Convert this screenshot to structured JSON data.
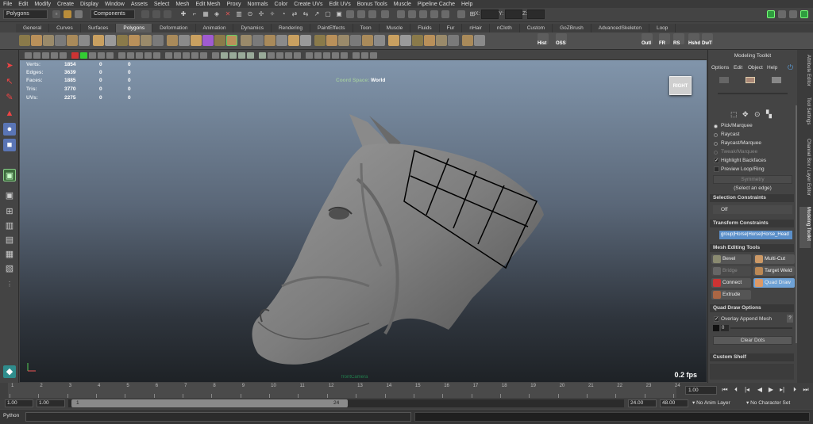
{
  "menubar": [
    "File",
    "Edit",
    "Modify",
    "Create",
    "Display",
    "Window",
    "Assets",
    "Select",
    "Mesh",
    "Edit Mesh",
    "Proxy",
    "Normals",
    "Color",
    "Create UVs",
    "Edit UVs",
    "Bonus Tools",
    "Muscle",
    "Pipeline Cache",
    "Help"
  ],
  "status_line": {
    "menuset": "Polygons",
    "selection_mode": "Components",
    "xyz_labels": [
      "X:",
      "Y:",
      "Z:"
    ]
  },
  "shelf_tabs": [
    "General",
    "Curves",
    "Surfaces",
    "Polygons",
    "Deformation",
    "Animation",
    "Dynamics",
    "Rendering",
    "PaintEffects",
    "Toon",
    "Muscle",
    "Fluids",
    "Fur",
    "nHair",
    "nCloth",
    "Custom",
    "GoZBrush",
    "AdvancedSkeleton",
    "Loop"
  ],
  "active_shelf_tab": "Polygons",
  "shelf_labels": [
    "Hist",
    "OSS",
    "Outl",
    "FR",
    "RS",
    "Hshd",
    "DwT"
  ],
  "hud": {
    "rows": [
      {
        "label": "Verts:",
        "values": [
          "1854",
          "0",
          "0"
        ]
      },
      {
        "label": "Edges:",
        "values": [
          "3639",
          "0",
          "0"
        ]
      },
      {
        "label": "Faces:",
        "values": [
          "1885",
          "0",
          "0"
        ]
      },
      {
        "label": "Tris:",
        "values": [
          "3770",
          "0",
          "0"
        ]
      },
      {
        "label": "UVs:",
        "values": [
          "2275",
          "0",
          "0"
        ]
      }
    ],
    "coord_label": "Coord Space:",
    "coord_value": "World",
    "viewcube": "RIGHT",
    "fps": "0.2 fps",
    "camera": "frontCamera"
  },
  "modeling_toolkit": {
    "title": "Modeling Toolkit",
    "menus": [
      "Options",
      "Edit",
      "Object",
      "Help"
    ],
    "pick_options": [
      "Pick/Marquee",
      "Raycast",
      "Raycast/Marquee",
      "Tweak/Marquee"
    ],
    "highlight_backfaces": "Highlight Backfaces",
    "preview_loop_ring": "Preview Loop/Ring",
    "symmetry": "Symmetry",
    "select_edge_hint": "(Select an edge)",
    "selection_constraints": "Selection Constraints",
    "constraint_value": "Off",
    "transform_constraints": "Transform Constraints",
    "transform_target": "group|Horse|Horse|Horse_Head",
    "mesh_editing_tools": "Mesh Editing Tools",
    "tools": [
      "Bevel",
      "Multi-Cut",
      "Bridge",
      "Target Weld",
      "Connect",
      "Quad Draw",
      "Extrude"
    ],
    "quad_draw_options": "Quad Draw Options",
    "overlay_append": "Overlay Append Mesh",
    "overlay_value": "0",
    "clear_dots": "Clear Dots",
    "custom_shelf": "Custom Shelf"
  },
  "side_tabs": [
    "Attribute Editor",
    "Tool Settings",
    "Channel Box / Layer Editor",
    "Modeling Toolkit"
  ],
  "timeline": {
    "ticks": [
      "1",
      "2",
      "3",
      "4",
      "5",
      "6",
      "7",
      "8",
      "9",
      "10",
      "11",
      "12",
      "13",
      "14",
      "15",
      "16",
      "17",
      "18",
      "19",
      "20",
      "21",
      "22",
      "23",
      "24"
    ],
    "current_frame": "1.00"
  },
  "range": {
    "start": "1.00",
    "anim_start": "1.00",
    "range_start": "1",
    "range_end": "24",
    "anim_end": "24.00",
    "end": "48.00",
    "anim_layer": "No Anim Layer",
    "character_set": "No Character Set"
  },
  "command_line": {
    "language": "Python"
  },
  "colors": {
    "accent": "#5b8fc9",
    "active_tool": "#6fa2d6",
    "viewport_top": "#8195ab",
    "viewport_bottom": "#1e2226"
  }
}
